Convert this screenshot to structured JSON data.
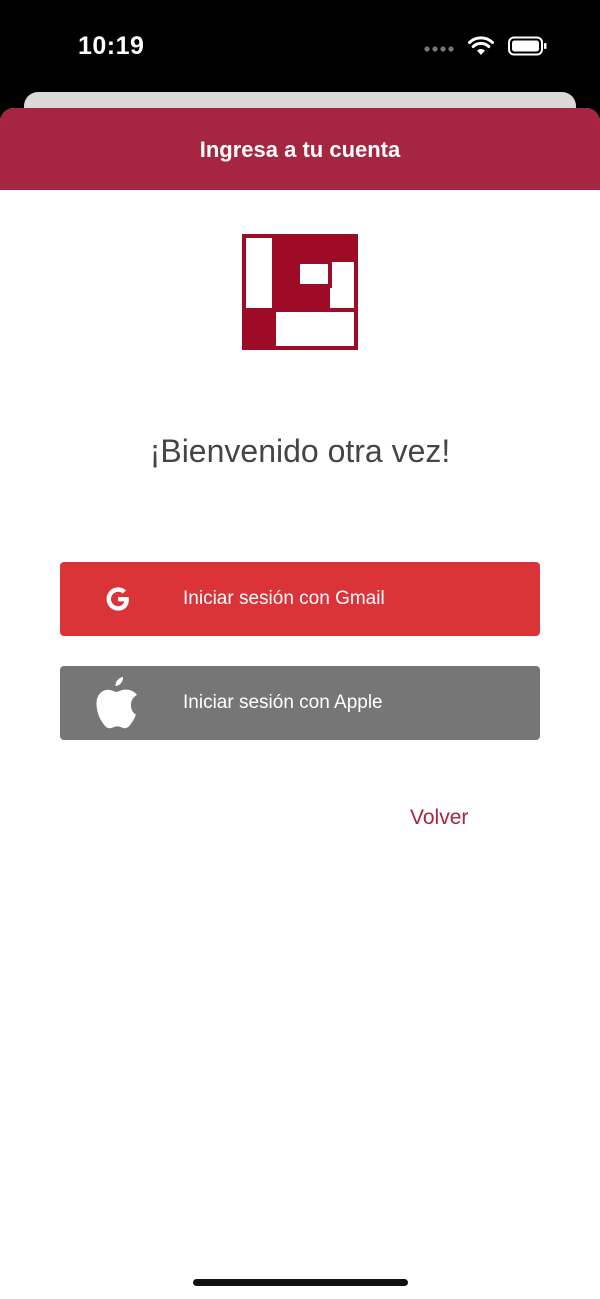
{
  "status_bar": {
    "time": "10:19",
    "icons": [
      "signal-dots-icon",
      "wifi-icon",
      "battery-icon"
    ]
  },
  "header": {
    "title": "Ingresa a tu cuenta"
  },
  "logo": {
    "icon": "lc-logo-icon",
    "color": "#9e0b26"
  },
  "main": {
    "welcome": "¡Bienvenido otra vez!"
  },
  "buttons": {
    "gmail": {
      "label": "Iniciar sesión con Gmail",
      "icon": "google-icon",
      "color": "#da3338"
    },
    "apple": {
      "label": "Iniciar sesión con Apple",
      "icon": "apple-icon",
      "color": "#767676"
    }
  },
  "back_link": {
    "label": "Volver",
    "color": "#a62541"
  },
  "colors": {
    "brand": "#a62541",
    "text": "#454545"
  }
}
